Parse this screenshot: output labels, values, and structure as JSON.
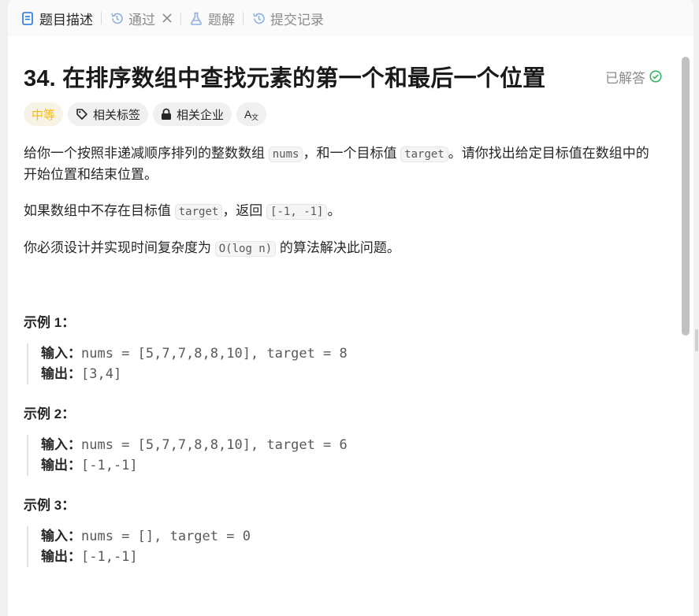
{
  "tabs": [
    {
      "label": "题目描述",
      "icon": "document-icon",
      "active": true
    },
    {
      "label": "通过",
      "icon": "history-icon",
      "active": false,
      "closable": true
    },
    {
      "label": "题解",
      "icon": "flask-icon",
      "active": false
    },
    {
      "label": "提交记录",
      "icon": "history-icon",
      "active": false
    }
  ],
  "problem": {
    "title": "34. 在排序数组中查找元素的第一个和最后一个位置",
    "status": "已解答",
    "difficulty": "中等",
    "tags": [
      "相关标签",
      "相关企业"
    ],
    "translate_glyph": "A",
    "translate_glyph2": "文"
  },
  "description": {
    "p1_a": "给你一个按照非递减顺序排列的整数数组 ",
    "p1_code1": "nums",
    "p1_b": "，和一个目标值 ",
    "p1_code2": "target",
    "p1_c": "。请你找出给定目标值在数组中的开始位置和结束位置。",
    "p2_a": "如果数组中不存在目标值 ",
    "p2_code1": "target",
    "p2_b": "，返回 ",
    "p2_code2": "[-1, -1]",
    "p2_c": "。",
    "p3_a": "你必须设计并实现时间复杂度为 ",
    "p3_code1": "O(log n)",
    "p3_b": " 的算法解决此问题。"
  },
  "examples": [
    {
      "title": "示例 1：",
      "input_label": "输入：",
      "input": "nums = [5,7,7,8,8,10], target = 8",
      "output_label": "输出：",
      "output": "[3,4]"
    },
    {
      "title": "示例 2：",
      "input_label": "输入：",
      "input": "nums = [5,7,7,8,8,10], target = 6",
      "output_label": "输出：",
      "output": "[-1,-1]"
    },
    {
      "title": "示例 3：",
      "input_label": "输入：",
      "input": "nums = [], target = 0",
      "output_label": "输出：",
      "output": "[-1,-1]"
    }
  ],
  "colors": {
    "accent_medium": "#ffb800",
    "solved_green": "#2db55d"
  }
}
